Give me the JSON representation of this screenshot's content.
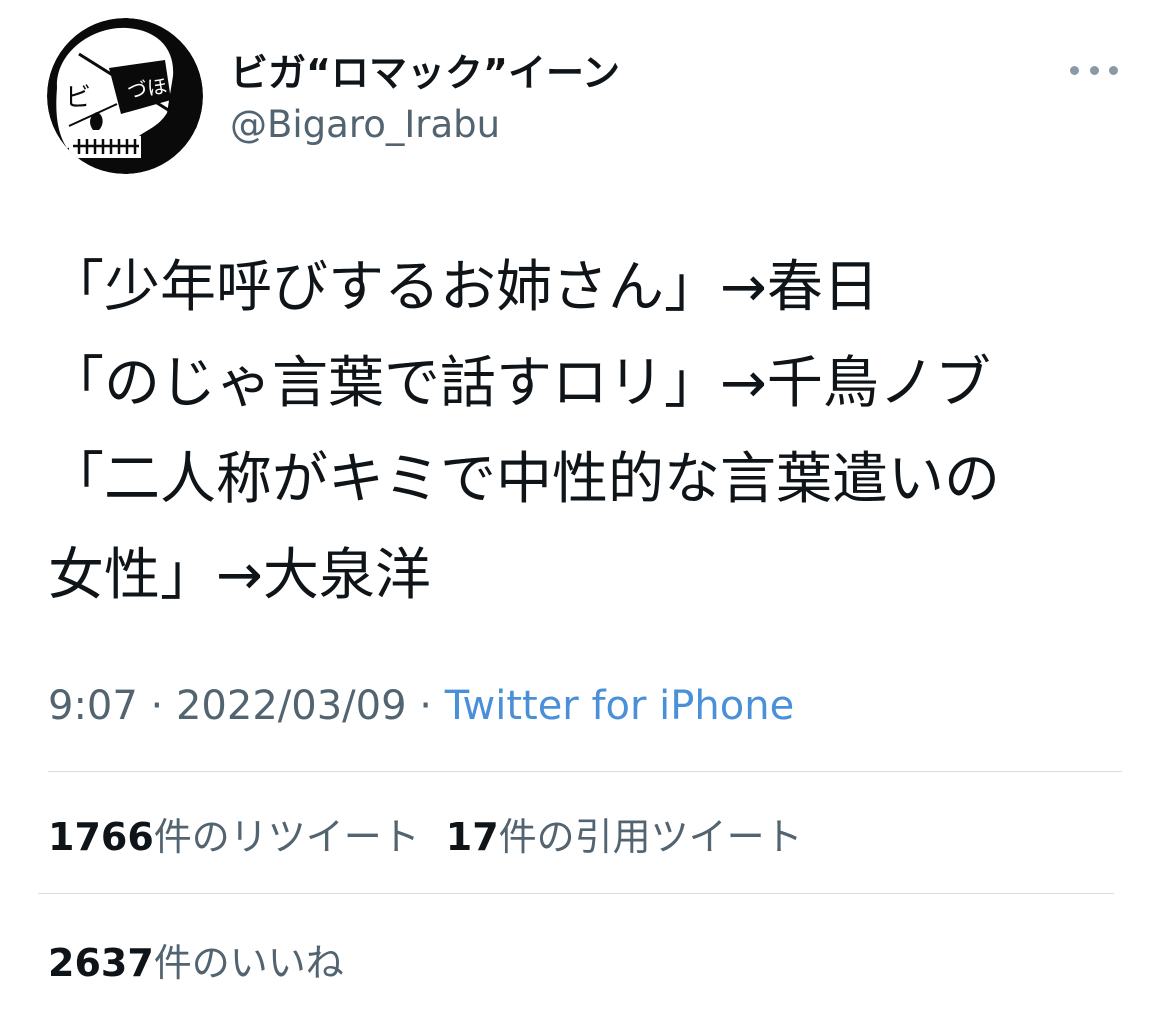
{
  "author": {
    "display_name": "ビガ“ロマック”イーン",
    "handle": "@Bigaro_Irabu",
    "avatar_text_left": "ビ",
    "avatar_text_patch": "づほ"
  },
  "tweet": {
    "lines": [
      "「少年呼びするお姉さん」→春日",
      "「のじゃ言葉で話すロリ」→千鳥ノブ",
      "「二人称がキミで中性的な言葉遣いの",
      "女性」→大泉洋"
    ]
  },
  "meta": {
    "time": "9:07",
    "separator": " · ",
    "date": "2022/03/09",
    "source": "Twitter for iPhone"
  },
  "stats": {
    "retweets_count": "1766",
    "retweets_label": "件のリツイート",
    "quotes_count": "17",
    "quotes_label": "件の引用ツイート",
    "likes_count": "2637",
    "likes_label": "件のいいね"
  },
  "colors": {
    "text_primary": "#0f1419",
    "text_secondary": "#536471",
    "link": "#4a90d9",
    "divider": "#d8dde2"
  },
  "icons": {
    "more": "more-horizontal-icon",
    "avatar": "skull-avatar-icon"
  }
}
